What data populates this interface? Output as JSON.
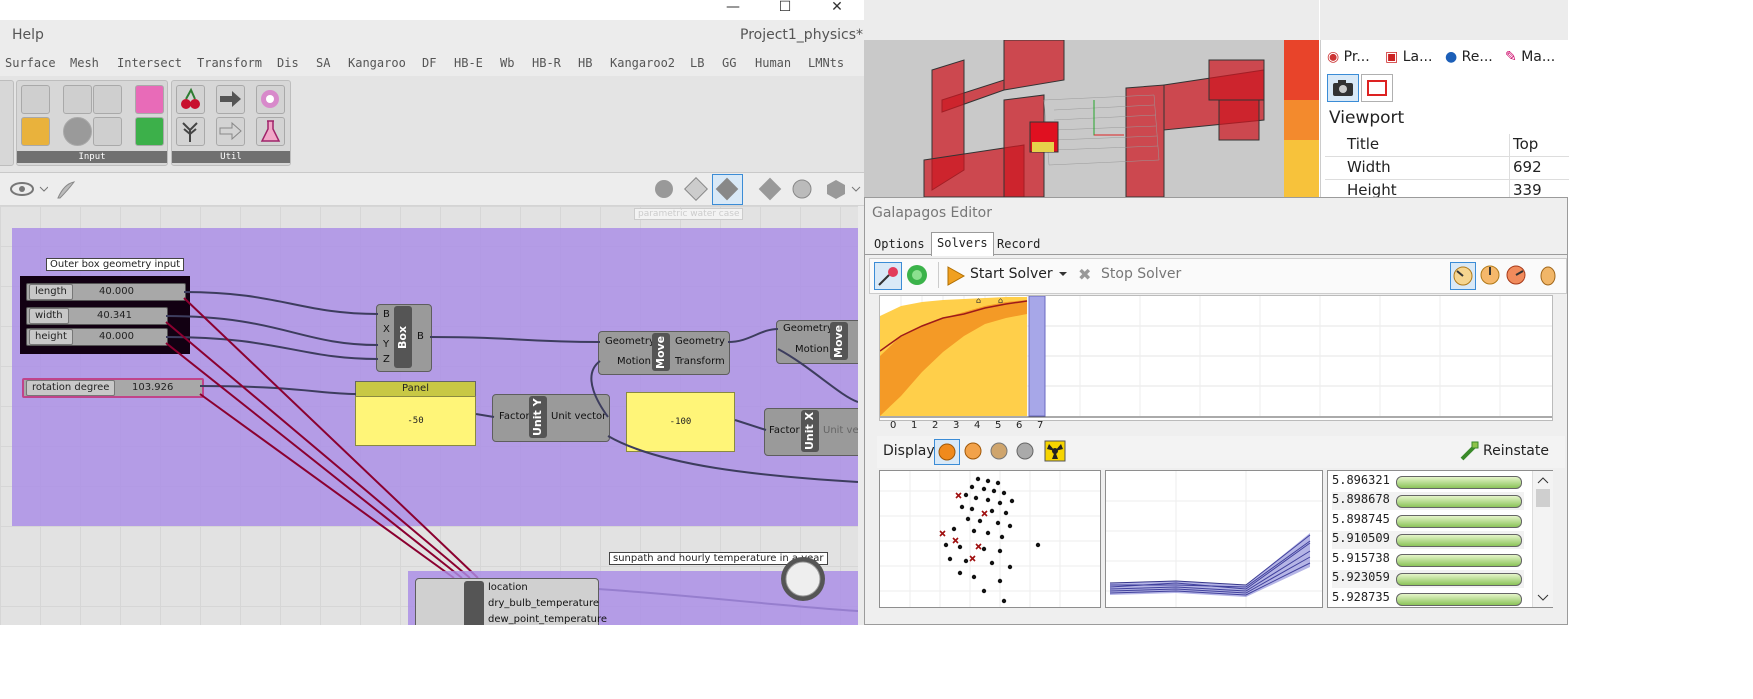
{
  "gh": {
    "window_controls": [
      "—",
      "☐",
      "✕"
    ],
    "menu_help": "Help",
    "doc_title": "Project1_physics*",
    "menu_tabs": [
      "Surface",
      "Mesh",
      "Intersect",
      "Transform",
      "Dis",
      "SA",
      "Kangaroo",
      "DF",
      "HB-E",
      "Wb",
      "HB-R",
      "HB",
      "Kangaroo2",
      "LB",
      "GG",
      "Human",
      "LMNts"
    ],
    "ribbon_groups": [
      "Input",
      "Util"
    ],
    "canvas_hint": "parametric water case",
    "group1_title": "Outer box geometry input",
    "sliders": [
      {
        "label": "length",
        "value": "40.000"
      },
      {
        "label": "width",
        "value": "40.341"
      },
      {
        "label": "height",
        "value": "40.000"
      },
      {
        "label": "rotation degree",
        "value": "103.926"
      }
    ],
    "box": {
      "inputs": [
        "B",
        "X",
        "Y",
        "Z"
      ],
      "name": "Box",
      "output": "B"
    },
    "panel": {
      "title": "Panel",
      "value": "-50"
    },
    "unit_y": {
      "input": "Factor",
      "name": "Unit Y",
      "output": "Unit vector"
    },
    "panel2_value": "-100",
    "move1": {
      "inputs": [
        "Geometry",
        "Motion"
      ],
      "name": "Move",
      "outputs": [
        "Geometry",
        "Transform"
      ]
    },
    "move2": {
      "inputs": [
        "Geometry",
        "Motion"
      ],
      "name": "Move"
    },
    "unit_x": {
      "input": "Factor",
      "name": "Unit X",
      "output": "Unit ve"
    },
    "group2_title": "sunpath and hourly temperature in a year",
    "weather_outputs": [
      "location",
      "dry_bulb_temperature",
      "dew_point_temperature"
    ]
  },
  "props": {
    "tabs": [
      "Pr...",
      "La...",
      "Re...",
      "Ma..."
    ],
    "section": "Viewport",
    "rows": [
      {
        "key": "Title",
        "value": "Top"
      },
      {
        "key": "Width",
        "value": "692"
      },
      {
        "key": "Height",
        "value": "339"
      }
    ]
  },
  "galapagos": {
    "title": "Galapagos Editor",
    "tabs": [
      "Options",
      "Solvers",
      "Record"
    ],
    "active_tab": "Solvers",
    "start_label": "Start Solver",
    "stop_label": "Stop Solver",
    "x_ticks": [
      "0",
      "1",
      "2",
      "3",
      "4",
      "5",
      "6",
      "7"
    ],
    "display_label": "Display",
    "reinstate_label": "Reinstate",
    "fitness_values": [
      "5.896321",
      "5.898678",
      "5.898745",
      "5.910509",
      "5.915738",
      "5.923059",
      "5.928735"
    ]
  }
}
